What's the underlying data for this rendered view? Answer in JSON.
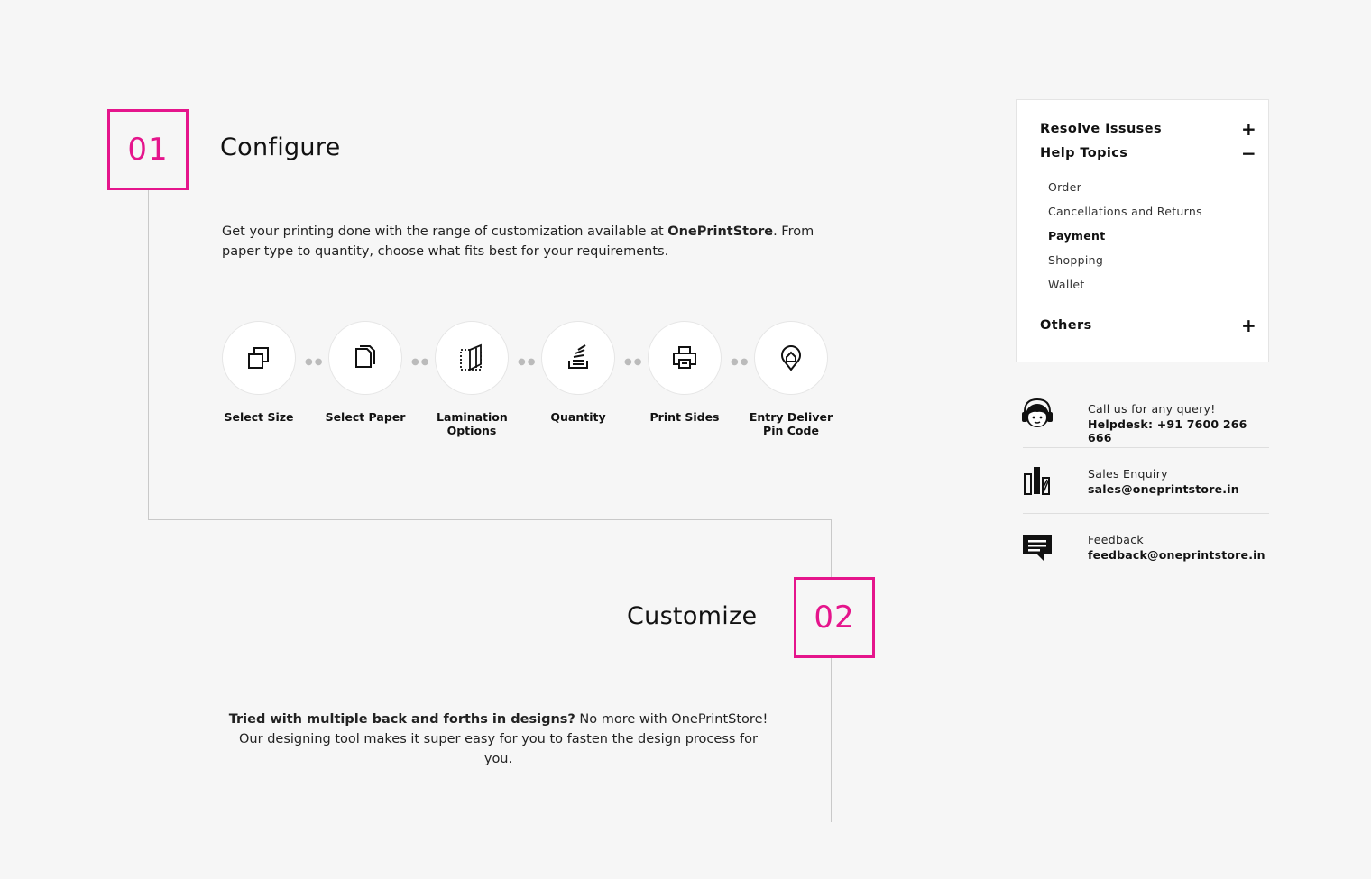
{
  "accent_color": "#e5158c",
  "step1": {
    "number": "01",
    "title": "Configure",
    "desc_pre": "Get your printing done with the range of customization available at ",
    "desc_brand": "OnePrintStore",
    "desc_post": ". From paper type to quantity, choose what fits best for your requirements."
  },
  "options": [
    {
      "icon": "copy-size-icon",
      "label": "Select Size"
    },
    {
      "icon": "paper-stack-icon",
      "label": "Select Paper"
    },
    {
      "icon": "lamination-icon",
      "label": "Lamination Options"
    },
    {
      "icon": "quantity-stack-icon",
      "label": "Quantity"
    },
    {
      "icon": "printer-icon",
      "label": "Print Sides"
    },
    {
      "icon": "location-pin-home-icon",
      "label": "Entry Deliver Pin Code"
    }
  ],
  "step2": {
    "number": "02",
    "title": "Customize",
    "desc_bold": "Tried with multiple back and forths in designs?",
    "desc_rest": " No more with OnePrintStore! Our designing tool makes it super easy for you to fasten the design process for you."
  },
  "help": {
    "sections": [
      {
        "label": "Resolve Issuses",
        "sign": "+"
      },
      {
        "label": "Help Topics",
        "sign": "−"
      },
      {
        "label": "Others",
        "sign": "+"
      }
    ],
    "topics": [
      "Order",
      "Cancellations and Returns",
      "Payment",
      "Shopping",
      "Wallet"
    ],
    "active_topic": "Payment"
  },
  "contacts": [
    {
      "icon": "headset-agent-icon",
      "line1": "Call us for any query!",
      "line2": "Helpdesk: +91 7600 266 666"
    },
    {
      "icon": "sales-chart-icon",
      "line1": "Sales Enquiry",
      "line2": "sales@oneprintstore.in"
    },
    {
      "icon": "feedback-chat-icon",
      "line1": "Feedback",
      "line2": "feedback@oneprintstore.in"
    }
  ]
}
